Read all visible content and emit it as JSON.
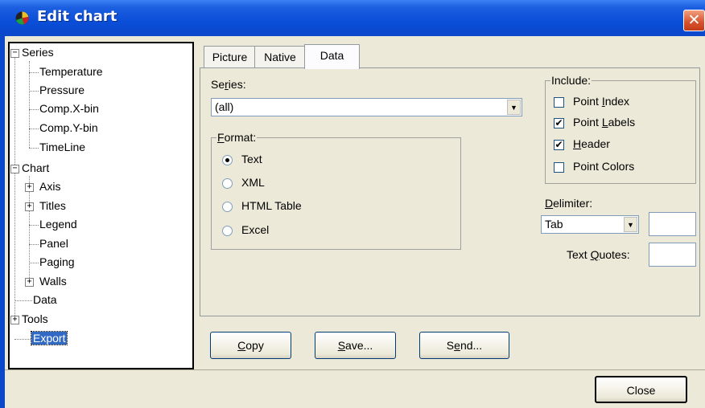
{
  "window": {
    "title": "Edit chart",
    "close_glyph": "✕"
  },
  "tree": {
    "series_label": "Series",
    "series_items": [
      "Temperature",
      "Pressure",
      "Comp.X-bin",
      "Comp.Y-bin",
      "TimeLine"
    ],
    "chart_label": "Chart",
    "chart_items": [
      "Axis",
      "Titles",
      "Legend",
      "Panel",
      "Paging",
      "Walls"
    ],
    "data_label": "Data",
    "tools_label": "Tools",
    "export_label": "Export",
    "expander_minus": "−",
    "expander_plus": "+"
  },
  "tabs": [
    "Picture",
    "Native",
    "Data"
  ],
  "active_tab": "Data",
  "data_tab": {
    "series_label_pre": "Se",
    "series_label_acc": "r",
    "series_label_post": "ies:",
    "series_value": "(all)",
    "format_label_acc": "F",
    "format_label_post": "ormat:",
    "format_options": [
      "Text",
      "XML",
      "HTML Table",
      "Excel"
    ],
    "format_selected": "Text",
    "include_label": "Include:",
    "include_options": [
      {
        "pre": "Point ",
        "acc": "I",
        "post": "ndex",
        "checked": false
      },
      {
        "pre": "Point ",
        "acc": "L",
        "post": "abels",
        "checked": true
      },
      {
        "pre": "",
        "acc": "H",
        "post": "eader",
        "checked": true
      },
      {
        "pre": "Point Colors",
        "acc": "",
        "post": "",
        "checked": false
      }
    ],
    "delimiter_label_acc": "D",
    "delimiter_label_post": "elimiter:",
    "delimiter_value": "Tab",
    "text_quotes_pre": "Text ",
    "text_quotes_acc": "Q",
    "text_quotes_post": "uotes:"
  },
  "buttons": {
    "copy_acc": "C",
    "copy_post": "opy",
    "save_acc": "S",
    "save_post": "ave...",
    "send_pre": "S",
    "send_acc": "e",
    "send_post": "nd...",
    "close": "Close"
  },
  "icons": {
    "dropdown_arrow": "▼",
    "check_mark": "✔"
  },
  "colors": {
    "titlebar": "#0a4ed8",
    "selection": "#316ac5",
    "dialog_bg": "#ece9d8"
  }
}
